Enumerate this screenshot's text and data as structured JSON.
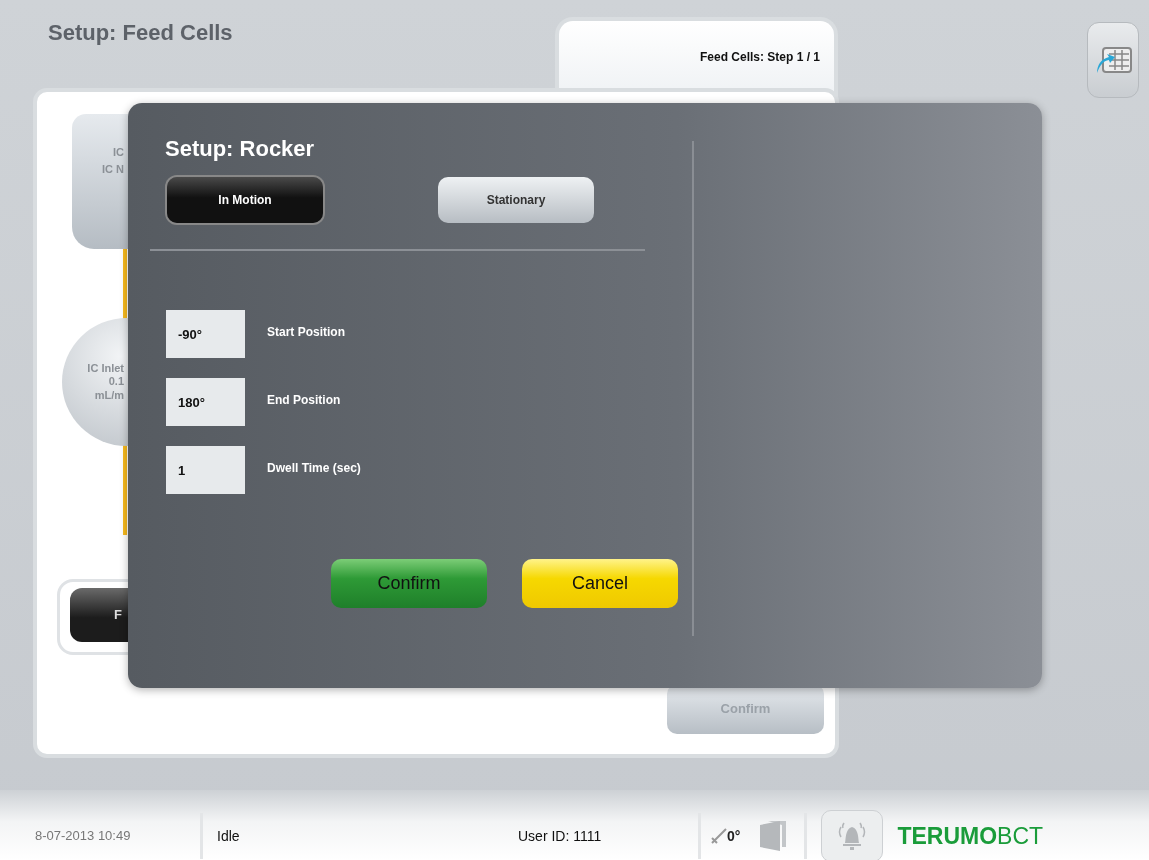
{
  "header": {
    "title": "Setup: Feed Cells",
    "step": "Feed Cells:  Step 1 / 1"
  },
  "background": {
    "bag_lines": [
      "IC",
      "IC N"
    ],
    "pump_lines": [
      "IC Inlet",
      "0.1",
      "mL/m"
    ],
    "dark_button": "F",
    "confirm": {
      "label": "Confirm",
      "disabled": true
    }
  },
  "dialog": {
    "title": "Setup: Rocker",
    "modes": [
      {
        "label": "In Motion",
        "selected": true
      },
      {
        "label": "Stationary",
        "selected": false
      }
    ],
    "fields": [
      {
        "value": "-90°",
        "label": "Start Position"
      },
      {
        "value": "180°",
        "label": "End Position"
      },
      {
        "value": "1",
        "label": "Dwell Time (sec)"
      }
    ],
    "buttons": [
      {
        "label": "Confirm",
        "kind": "confirm"
      },
      {
        "label": "Cancel",
        "kind": "cancel"
      }
    ]
  },
  "status_bar": {
    "datetime": "8-07-2013 10:49",
    "state": "Idle",
    "user": "User ID: 1111",
    "rocker_angle": "0°",
    "logo": "**TERUMO**BCT"
  }
}
